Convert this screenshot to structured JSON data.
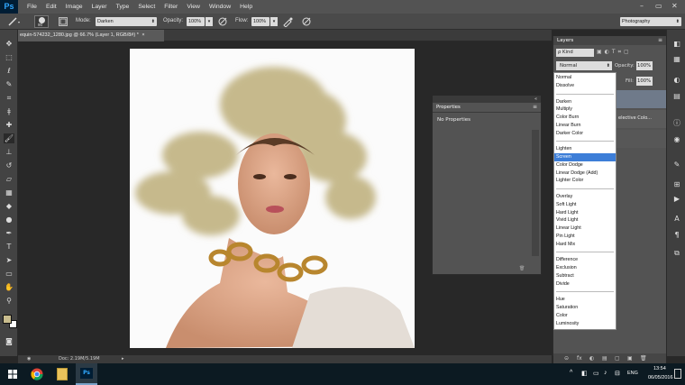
{
  "app": {
    "logo": "Ps"
  },
  "menubar": {
    "items": [
      "File",
      "Edit",
      "Image",
      "Layer",
      "Type",
      "Select",
      "Filter",
      "View",
      "Window",
      "Help"
    ]
  },
  "window_controls": {
    "minimize": "–",
    "restore": "▭",
    "close": "✕"
  },
  "options": {
    "brush_size": "90",
    "mode_label": "Mode:",
    "mode_value": "Darken",
    "opacity_label": "Opacity:",
    "opacity_value": "100%",
    "flow_label": "Flow:",
    "flow_value": "100%",
    "workspace": "Photography"
  },
  "document": {
    "tab_title": "equin-574232_1280.jpg @ 66.7% (Layer 1, RGB/8#) *",
    "tab_close": "×",
    "status": "Doc: 2.19M/5.19M"
  },
  "properties": {
    "tab": "Properties",
    "content": "No Properties",
    "collapse": "«",
    "menu": "≡",
    "trash_icon": "🗑"
  },
  "layers": {
    "tab": "Layers",
    "kind_label": "ρ Kind",
    "blend_value": "Normal",
    "opacity_label": "Opacity:",
    "opacity_value": "100%",
    "fill_label": "Fill:",
    "fill_value": "100%",
    "layer_snippet": "elective Colo...",
    "bottom_icons": [
      "⊝",
      "fx",
      "◐",
      "▤",
      "▢",
      "▣",
      "🗑"
    ]
  },
  "blend_modes": {
    "groups": [
      [
        "Normal",
        "Dissolve"
      ],
      [
        "Darken",
        "Multiply",
        "Color Burn",
        "Linear Burn",
        "Darker Color"
      ],
      [
        "Lighten",
        "Screen",
        "Color Dodge",
        "Linear Dodge (Add)",
        "Lighter Color"
      ],
      [
        "Overlay",
        "Soft Light",
        "Hard Light",
        "Vivid Light",
        "Linear Light",
        "Pin Light",
        "Hard Mix"
      ],
      [
        "Difference",
        "Exclusion",
        "Subtract",
        "Divide"
      ],
      [
        "Hue",
        "Saturation",
        "Color",
        "Luminosity"
      ]
    ],
    "selected": "Screen"
  },
  "taskbar": {
    "time": "13:54",
    "date": "06/05/2016",
    "language": "ENG",
    "tray_icons": [
      "^",
      "◧",
      "▭",
      "♪",
      "⊟"
    ]
  },
  "colors": {
    "foreground": "#c9bd8e",
    "background": "#ffffff",
    "accent": "#3d7ed8"
  }
}
